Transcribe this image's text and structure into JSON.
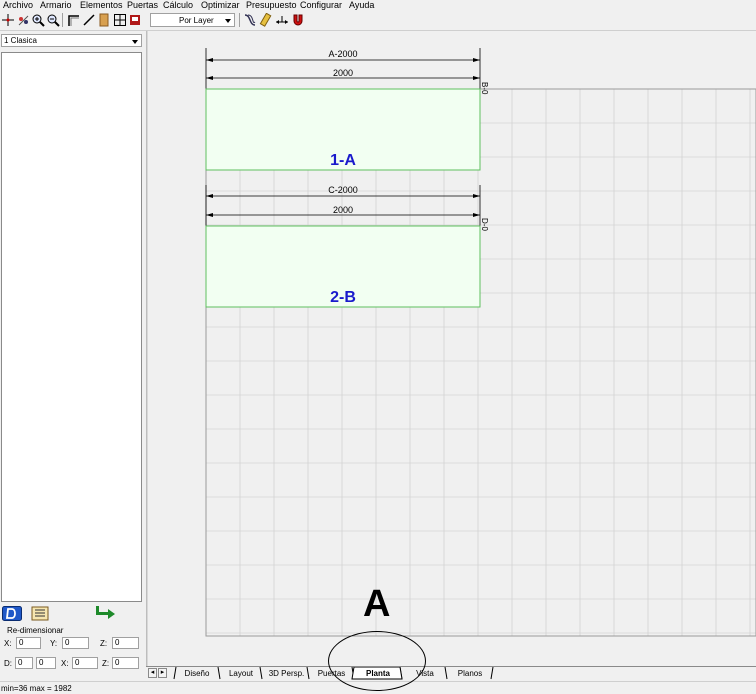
{
  "menu": [
    "Archivo",
    "Armario",
    "Elementos",
    "Puertas",
    "Cálculo",
    "Optimizar",
    "Presupuesto",
    "Configurar",
    "Ayuda"
  ],
  "toolbar": {
    "layer_select": "Por Layer"
  },
  "left_panel": {
    "profile_select": "1 Clasica",
    "resize_label": "Re-dimensionar",
    "fields": {
      "x_label": "X:",
      "x_value": "0",
      "y_label": "Y:",
      "y_value": "0",
      "z_label": "Z:",
      "z_value": "0",
      "d_label": "D:",
      "d_value1": "0",
      "d_value2": "0",
      "x2_label": "X:",
      "x2_value": "0",
      "z2_label": "Z:",
      "z2_value": "0"
    }
  },
  "drawing": {
    "panels": [
      {
        "top_dim": "A-2000",
        "width_dim": "2000",
        "side_label": "B-0",
        "name": "1-A"
      },
      {
        "top_dim": "C-2000",
        "width_dim": "2000",
        "side_label": "D-0",
        "name": "2-B"
      }
    ],
    "panel_fill": "#f2fff2",
    "panel_stroke": "#5fbf5f",
    "label_color": "#1a1acc",
    "grid_color": "#d4d4d4"
  },
  "tabs": {
    "items": [
      "Diseño",
      "Layout",
      "3D Persp.",
      "Puertas",
      "Planta",
      "Vista",
      "Planos"
    ],
    "active": "Planta"
  },
  "status_text": "min=36  max = 1982",
  "annotation": {
    "letter": "A"
  }
}
